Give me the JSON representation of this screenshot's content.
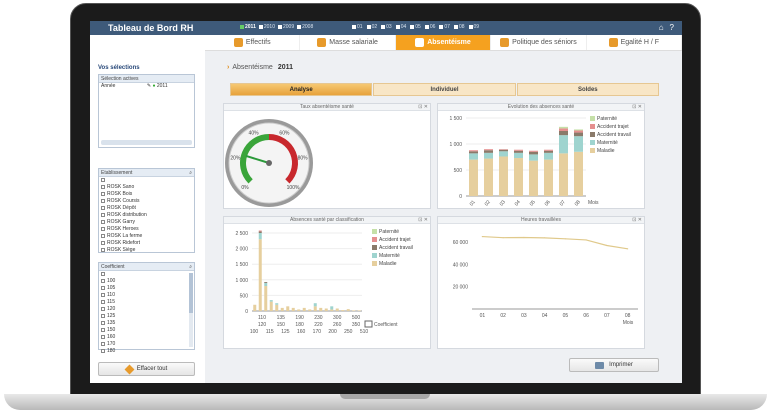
{
  "app": {
    "title": "Tableau de Bord RH"
  },
  "years": [
    {
      "label": "2011",
      "active": true
    },
    {
      "label": "2010",
      "active": false
    },
    {
      "label": "2009",
      "active": false
    },
    {
      "label": "2008",
      "active": false
    }
  ],
  "months": [
    "01",
    "02",
    "03",
    "04",
    "05",
    "06",
    "07",
    "08",
    "09"
  ],
  "top_icons": [
    "home-icon",
    "help-icon"
  ],
  "nav_tabs": [
    {
      "label": "Effectifs",
      "icon": "people-icon",
      "active": false
    },
    {
      "label": "Masse salariale",
      "icon": "money-icon",
      "active": false
    },
    {
      "label": "Absentéisme",
      "icon": "absence-icon",
      "active": true
    },
    {
      "label": "Politique des séniors",
      "icon": "senior-icon",
      "active": false
    },
    {
      "label": "Egalité H / F",
      "icon": "gender-icon",
      "active": false
    }
  ],
  "sidebar": {
    "title": "Vos sélections",
    "active_selection": {
      "header": "Sélection actives",
      "row_label": "Année",
      "row_value": "2011"
    },
    "etablissement": {
      "header": "Etablissement",
      "items": [
        "ROSK Sano",
        "ROSK Bois",
        "ROSK Coursis",
        "ROSK Dépôt",
        "ROSK distribution",
        "ROSK Garry",
        "ROSK Heroes",
        "ROSK La ferme",
        "ROSK Ridefort",
        "ROSK Siège"
      ]
    },
    "coefficient": {
      "header": "Coefficient",
      "items": [
        "100",
        "105",
        "110",
        "115",
        "120",
        "125",
        "135",
        "150",
        "160",
        "170",
        "180"
      ]
    },
    "reset_label": "Effacer tout"
  },
  "main": {
    "breadcrumb_label": "Absentéisme",
    "breadcrumb_year": "2011",
    "sub_tabs": [
      {
        "label": "Analyse",
        "active": true
      },
      {
        "label": "Individuel",
        "active": false
      },
      {
        "label": "Soldes",
        "active": false
      }
    ],
    "print_label": "Imprimer"
  },
  "chart_data": [
    {
      "type": "gauge",
      "title": "Taux absentéisme santé",
      "ticks": [
        "0%",
        "20%",
        "40%",
        "60%",
        "80%",
        "100%"
      ],
      "value": 23,
      "colors": {
        "green": "#3aa53a",
        "red": "#c8282d"
      }
    },
    {
      "type": "bar",
      "stacked": true,
      "title": "Evolution des absences santé",
      "categories": [
        "01",
        "02",
        "03",
        "04",
        "05",
        "06",
        "07",
        "08"
      ],
      "xlabel": "Mois",
      "ylim": [
        0,
        1500
      ],
      "yticks": [
        "0",
        "500",
        "1 000",
        "1 500"
      ],
      "legend_position": "right",
      "series": [
        {
          "name": "Maladie",
          "color": "#e6cf9e",
          "values": [
            700,
            720,
            760,
            730,
            680,
            700,
            820,
            850
          ]
        },
        {
          "name": "Maternité",
          "color": "#9fd4cf",
          "values": [
            120,
            110,
            100,
            100,
            120,
            130,
            350,
            300
          ]
        },
        {
          "name": "Accident travail",
          "color": "#8a7a6a",
          "values": [
            40,
            50,
            30,
            40,
            50,
            40,
            80,
            70
          ]
        },
        {
          "name": "Accident trajet",
          "color": "#e58f8f",
          "values": [
            20,
            20,
            10,
            20,
            20,
            20,
            50,
            40
          ]
        },
        {
          "name": "Paternité",
          "color": "#c5e0a8",
          "values": [
            0,
            0,
            0,
            0,
            0,
            0,
            30,
            20
          ]
        }
      ]
    },
    {
      "type": "bar",
      "stacked": true,
      "title": "Absences santé par classification",
      "categories": [
        "100",
        "110",
        "115",
        "120",
        "125",
        "135",
        "150",
        "160",
        "170",
        "180",
        "190",
        "200",
        "220",
        "230",
        "250",
        "260",
        "300",
        "350",
        "500",
        "510"
      ],
      "x_tick_labels_row1": [
        "110",
        "135",
        "190",
        "230",
        "300",
        "500"
      ],
      "x_tick_labels_row2": [
        "120",
        "150",
        "180",
        "220",
        "260",
        "350"
      ],
      "x_tick_labels_row3": [
        "100",
        "115",
        "125",
        "160",
        "170",
        "200",
        "250",
        "510"
      ],
      "xlabel": "Coefficient",
      "ylim": [
        0,
        2500
      ],
      "yticks": [
        "0",
        "500",
        "1 000",
        "1 500",
        "2 000",
        "2 500"
      ],
      "legend_position": "right",
      "series": [
        {
          "name": "Maladie",
          "color": "#e6cf9e",
          "values": [
            200,
            2300,
            800,
            300,
            200,
            100,
            150,
            100,
            50,
            100,
            50,
            150,
            100,
            80,
            50,
            80,
            30,
            60,
            20,
            20
          ]
        },
        {
          "name": "Maternité",
          "color": "#9fd4cf",
          "values": [
            0,
            200,
            100,
            50,
            50,
            0,
            0,
            0,
            0,
            0,
            0,
            100,
            0,
            0,
            100,
            0,
            0,
            0,
            0,
            0
          ]
        },
        {
          "name": "Accident travail",
          "color": "#8a7a6a",
          "values": [
            0,
            50,
            30,
            0,
            0,
            0,
            0,
            0,
            0,
            0,
            0,
            0,
            0,
            0,
            0,
            0,
            0,
            0,
            0,
            0
          ]
        },
        {
          "name": "Accident trajet",
          "color": "#e58f8f",
          "values": [
            0,
            30,
            0,
            0,
            0,
            0,
            0,
            0,
            0,
            0,
            0,
            0,
            0,
            0,
            0,
            0,
            0,
            0,
            0,
            0
          ]
        },
        {
          "name": "Paternité",
          "color": "#c5e0a8",
          "values": [
            0,
            0,
            0,
            0,
            0,
            0,
            0,
            0,
            0,
            0,
            0,
            0,
            0,
            0,
            0,
            0,
            0,
            0,
            0,
            0
          ]
        }
      ]
    },
    {
      "type": "line",
      "title": "Heures travaillées",
      "x": [
        "01",
        "02",
        "03",
        "04",
        "05",
        "06",
        "07",
        "08"
      ],
      "y": [
        65000,
        64000,
        64200,
        63800,
        63000,
        62000,
        57000,
        54000
      ],
      "xlabel": "Mois",
      "ylim": [
        0,
        70000
      ],
      "yticks": [
        "0",
        "20 000",
        "40 000",
        "60 000"
      ],
      "color": "#e0c98b"
    }
  ]
}
